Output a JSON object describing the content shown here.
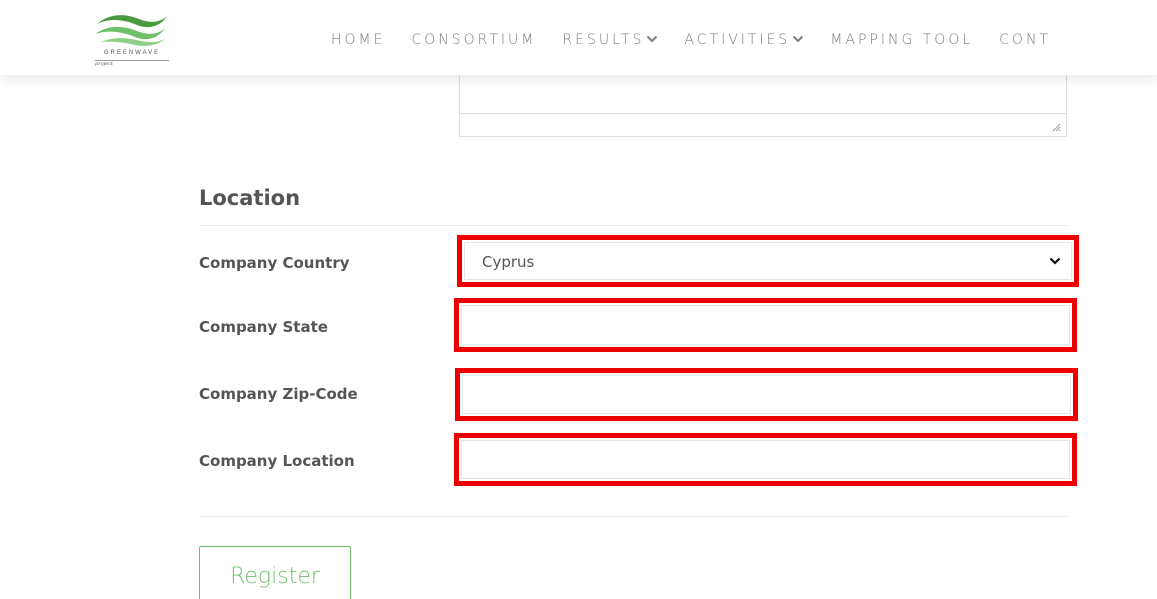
{
  "header": {
    "logo_text": "GREENWAVE",
    "logo_sub": "project",
    "nav": [
      {
        "label": "HOME",
        "has_dropdown": false
      },
      {
        "label": "CONSORTIUM",
        "has_dropdown": false
      },
      {
        "label": "RESULTS",
        "has_dropdown": true
      },
      {
        "label": "ACTIVITIES",
        "has_dropdown": true
      },
      {
        "label": "MAPPING TOOL",
        "has_dropdown": false
      },
      {
        "label": "CONT",
        "has_dropdown": false
      }
    ]
  },
  "location": {
    "title": "Location",
    "fields": [
      {
        "label": "Company Country",
        "type": "select",
        "value": "Cyprus"
      },
      {
        "label": "Company State",
        "type": "text",
        "value": ""
      },
      {
        "label": "Company Zip-Code",
        "type": "text",
        "value": ""
      },
      {
        "label": "Company Location",
        "type": "text",
        "value": ""
      }
    ]
  },
  "actions": {
    "register_label": "Register"
  },
  "colors": {
    "highlight_border": "#ee0000",
    "brand_green": "#6fc06b",
    "logo_green": "#4a9a3f"
  },
  "icons": {
    "select_chevron": "chevron-down-icon",
    "nav_chevron": "chevron-down-icon",
    "resize": "resize-grip-icon"
  }
}
